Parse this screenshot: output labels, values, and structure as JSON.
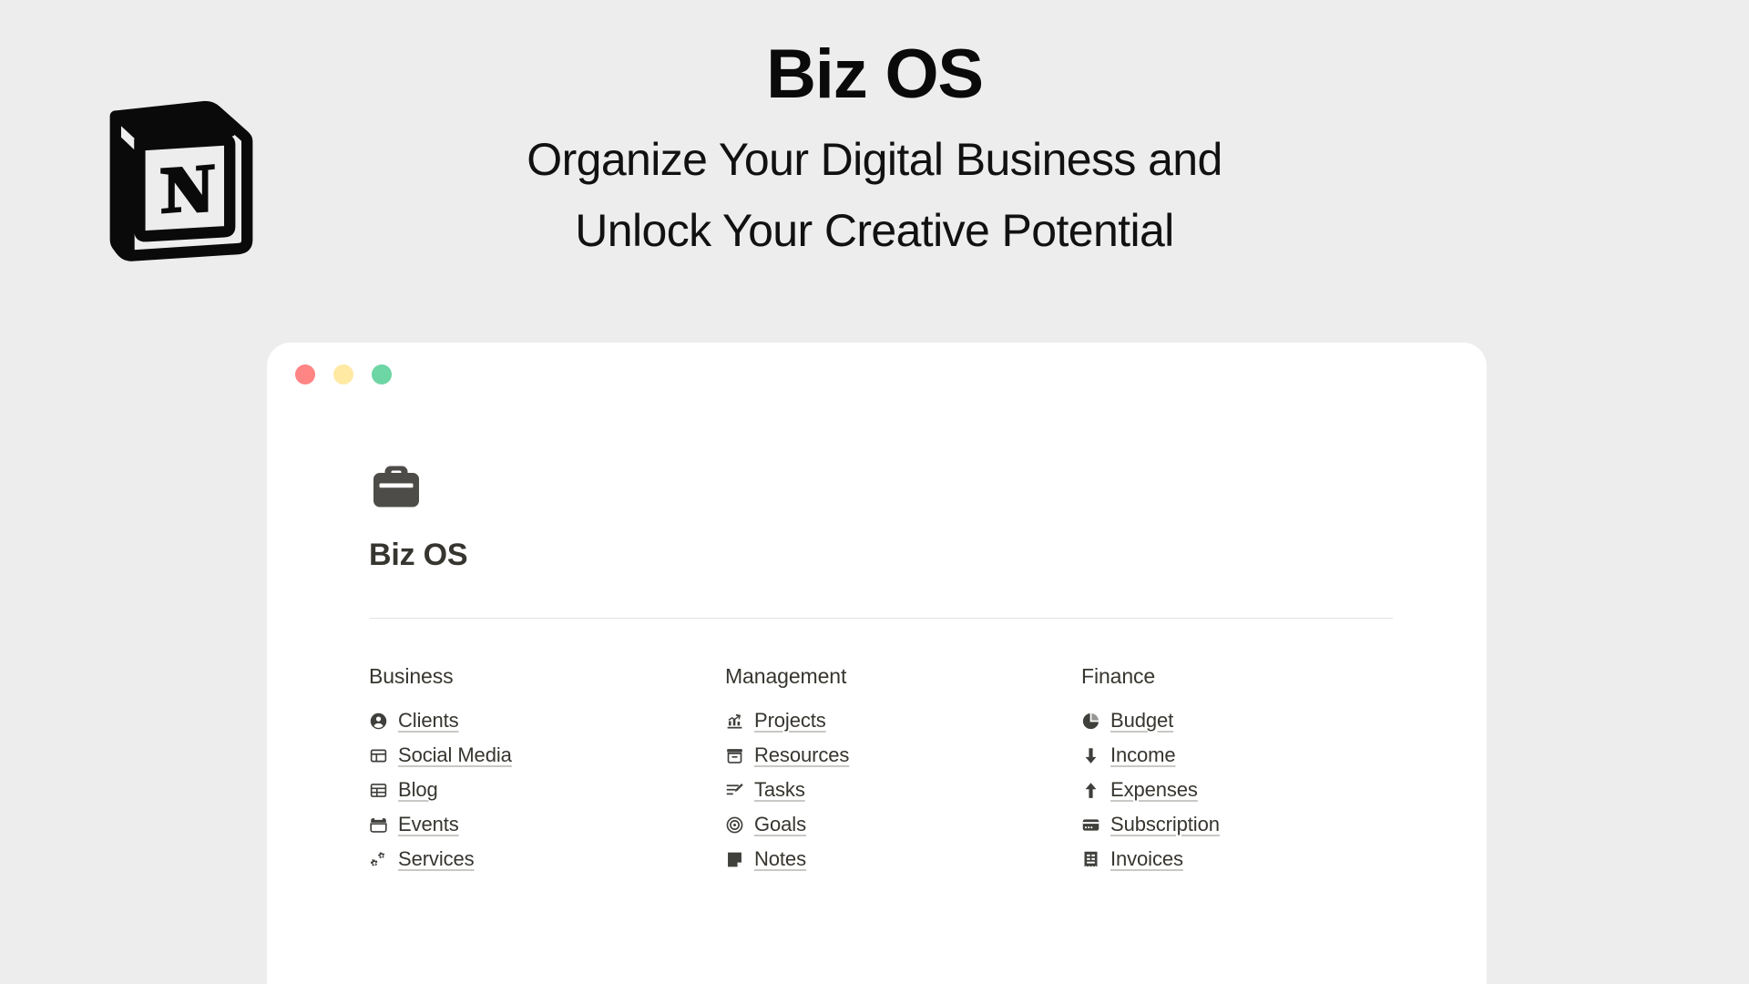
{
  "hero": {
    "logo_icon": "notion-logo-icon",
    "title": "Biz OS",
    "subtitle_line1": "Organize Your Digital Business and",
    "subtitle_line2": "Unlock Your Creative Potential"
  },
  "window": {
    "traffic_lights": [
      {
        "name": "close-button",
        "color": "#ff8585"
      },
      {
        "name": "minimize-button",
        "color": "#ffe9a3"
      },
      {
        "name": "maximize-button",
        "color": "#6dd6a4"
      }
    ]
  },
  "document": {
    "page_icon": "briefcase-icon",
    "page_title": "Biz OS"
  },
  "columns": [
    {
      "title": "Business",
      "links": [
        {
          "label": "Clients",
          "icon": "person-circle-icon"
        },
        {
          "label": "Social Media",
          "icon": "gallery-view-icon"
        },
        {
          "label": "Blog",
          "icon": "table-view-icon"
        },
        {
          "label": "Events",
          "icon": "calendar-icon"
        },
        {
          "label": "Services",
          "icon": "gears-icon"
        }
      ]
    },
    {
      "title": "Management",
      "links": [
        {
          "label": "Projects",
          "icon": "chart-growth-icon"
        },
        {
          "label": "Resources",
          "icon": "archive-box-icon"
        },
        {
          "label": "Tasks",
          "icon": "list-edit-icon"
        },
        {
          "label": "Goals",
          "icon": "target-icon"
        },
        {
          "label": "Notes",
          "icon": "note-page-icon"
        }
      ]
    },
    {
      "title": "Finance",
      "links": [
        {
          "label": "Budget",
          "icon": "pie-chart-icon"
        },
        {
          "label": "Income",
          "icon": "arrow-down-icon"
        },
        {
          "label": "Expenses",
          "icon": "arrow-up-icon"
        },
        {
          "label": "Subscription",
          "icon": "credit-card-icon"
        },
        {
          "label": "Invoices",
          "icon": "receipt-icon"
        }
      ]
    }
  ],
  "theme": {
    "background": "#ededed",
    "card_background": "#ffffff",
    "text": "#37352f",
    "icon": "#3f3f3c",
    "divider": "#e4e3e1"
  }
}
